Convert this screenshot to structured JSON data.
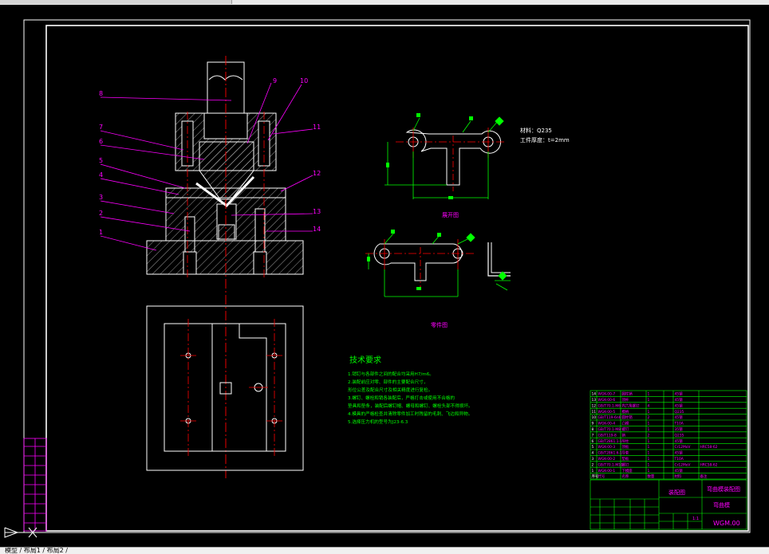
{
  "colors": {
    "background": "#000000",
    "magenta": "#ff00ff",
    "green": "#00ff00",
    "white": "#ffffff",
    "red": "#ff0000",
    "yellow": "#ffff00",
    "cyan": "#00ffff"
  },
  "leaders": [
    "8",
    "9",
    "10",
    "7",
    "6",
    "11",
    "5",
    "4",
    "12",
    "3",
    "2",
    "13",
    "14",
    "1"
  ],
  "part_view1": {
    "caption": "展开图",
    "material": "材料：Q235",
    "thickness": "工件厚度：t=2mm"
  },
  "part_view2": {
    "caption": "零件图"
  },
  "tech": {
    "title": "技术要求",
    "lines": [
      "1.销钉与各部件之间的配合均采用H7/m6。",
      "2.装配前应对零、部件的主要配合尺寸，",
      "  形位公差及配合尺寸及相关精度进行复检。",
      "3.螺钉、螺栓和销各装配后，严格打击或使用不合格的",
      "  垫具和垫条，装配后螺钉帽、螺母和螺钉、螺栓头部不得损坏。",
      "4.模具的严格检查并清除零件加工时残留的毛刺、飞边和异物。",
      "5.选择压力机的型号为J23-6.3"
    ]
  },
  "bom": [
    {
      "no": "14",
      "code": "WGK-00-7",
      "name": "圆柱销",
      "qty": "1",
      "mat": "45钢",
      "note": ""
    },
    {
      "no": "13",
      "code": "WGK-00-6",
      "name": "顶杆",
      "qty": "1",
      "mat": "45钢",
      "note": ""
    },
    {
      "no": "12",
      "code": "GB/T70.1-M6",
      "name": "内六角螺钉",
      "qty": "4",
      "mat": "45钢",
      "note": ""
    },
    {
      "no": "11",
      "code": "WGK-00-5",
      "name": "模柄",
      "qty": "1",
      "mat": "Q235",
      "note": ""
    },
    {
      "no": "10",
      "code": "GB/T119-6n6",
      "name": "圆柱销",
      "qty": "2",
      "mat": "45钢",
      "note": ""
    },
    {
      "no": "9",
      "code": "WGK-00-4",
      "name": "凸模",
      "qty": "1",
      "mat": "T10A",
      "note": ""
    },
    {
      "no": "8",
      "code": "GB/T70.1-M8",
      "name": "螺钉",
      "qty": "1",
      "mat": "35钢",
      "note": ""
    },
    {
      "no": "7",
      "code": "GB/T119-8",
      "name": "销",
      "qty": "2",
      "mat": "Q235",
      "note": ""
    },
    {
      "no": "6",
      "code": "GB/T2861.1-1",
      "name": "导柱",
      "qty": "1",
      "mat": "45钢",
      "note": ""
    },
    {
      "no": "5",
      "code": "WGK-00-3",
      "name": "顶板",
      "qty": "1",
      "mat": "Cr12MoV",
      "note": "HRC58-62"
    },
    {
      "no": "4",
      "code": "GB/T2861.6-1",
      "name": "导套",
      "qty": "1",
      "mat": "45钢",
      "note": ""
    },
    {
      "no": "3",
      "code": "WGK-00-2",
      "name": "垫板",
      "qty": "1",
      "mat": "T10A",
      "note": ""
    },
    {
      "no": "2",
      "code": "GB/T70.1-M10",
      "name": "螺钉",
      "qty": "1",
      "mat": "Cr12MoV",
      "note": "HRC58-62"
    },
    {
      "no": "1",
      "code": "WGK-00-1",
      "name": "下模座",
      "qty": "1",
      "mat": "45钢",
      "note": ""
    },
    {
      "no": "序号",
      "code": "代号",
      "name": "名称",
      "qty": "数量",
      "mat": "材料",
      "note": "备注"
    }
  ],
  "title_block": {
    "part_title": "弯曲模装配图",
    "drawing_title": "装配图",
    "subtitle": "弯曲模",
    "code": "WGM.00",
    "scale": "1:1"
  },
  "statusbar": {
    "tabs": "模型 / 布局1 / 布局2 /"
  }
}
